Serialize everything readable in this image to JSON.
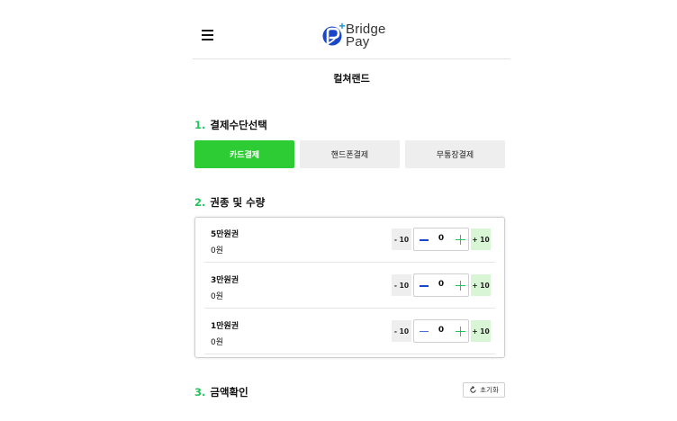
{
  "header": {
    "brand_line1": "Bridge",
    "brand_line2": "Pay",
    "colors": {
      "brand_blue": "#1a47c9",
      "brand_dark": "#333333"
    }
  },
  "store": {
    "name": "컬쳐랜드"
  },
  "sections": {
    "payment_method": {
      "number": "1.",
      "title": "결제수단선택"
    },
    "ticket": {
      "number": "2.",
      "title": "권종 및 수량"
    },
    "amount": {
      "number": "3.",
      "title": "금액확인"
    }
  },
  "payment_methods": [
    {
      "label": "카드결제",
      "selected": true
    },
    {
      "label": "핸드폰결제",
      "selected": false
    },
    {
      "label": "무통장결제",
      "selected": false
    }
  ],
  "tickets": [
    {
      "name": "5만원권",
      "amount": "0원",
      "quantity": "0",
      "minus10_label": "- 10",
      "plus10_label": "+ 10"
    },
    {
      "name": "3만원권",
      "amount": "0원",
      "quantity": "0",
      "minus10_label": "- 10",
      "plus10_label": "+ 10"
    },
    {
      "name": "1만원권",
      "amount": "0원",
      "quantity": "0",
      "minus10_label": "- 10",
      "plus10_label": "+ 10"
    }
  ],
  "reset_button": {
    "label": "초기화"
  },
  "colors": {
    "accent_green": "#2dcc35",
    "section_number_green": "#22c35a",
    "plus10_bg": "#d8f6d5"
  },
  "icons": {
    "menu": "hamburger-icon",
    "reset": "refresh-icon",
    "minus": "minus-icon",
    "plus": "plus-icon"
  }
}
